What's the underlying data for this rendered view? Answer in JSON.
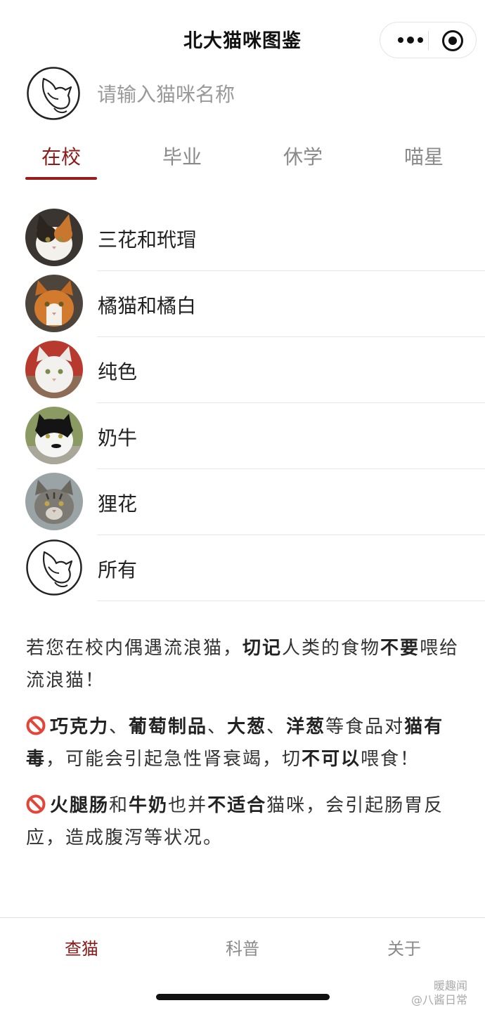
{
  "nav": {
    "title": "北大猫咪图鉴"
  },
  "search": {
    "placeholder": "请输入猫咪名称"
  },
  "tabs": [
    {
      "label": "在校",
      "active": true
    },
    {
      "label": "毕业",
      "active": false
    },
    {
      "label": "休学",
      "active": false
    },
    {
      "label": "喵星",
      "active": false
    }
  ],
  "categories": [
    {
      "label": "三花和玳瑁",
      "avatar": "calico-cat-photo"
    },
    {
      "label": "橘猫和橘白",
      "avatar": "orange-white-cat-photo"
    },
    {
      "label": "纯色",
      "avatar": "white-cat-photo"
    },
    {
      "label": "奶牛",
      "avatar": "tuxedo-cat-photo"
    },
    {
      "label": "狸花",
      "avatar": "tabby-cat-photo"
    },
    {
      "label": "所有",
      "avatar": "cat-logo-icon"
    }
  ],
  "notice": {
    "p1": {
      "a": "若您在校内偶遇流浪猫，",
      "b": "切记",
      "c": "人类的食物",
      "d": "不要",
      "e": "喂给流浪猫！"
    },
    "p2": {
      "icon": "prohibited-icon",
      "a": "巧克力",
      "b": "、",
      "c": "葡萄制品",
      "d": "、",
      "e": "大葱",
      "f": "、",
      "g": "洋葱",
      "h": "等食品对",
      "i": "猫有毒",
      "j": "，可能会引起急性肾衰竭，切",
      "k": "不可以",
      "l": "喂食！"
    },
    "p3": {
      "icon": "prohibited-icon",
      "a": "火腿肠",
      "b": "和",
      "c": "牛奶",
      "d": "也并",
      "e": "不适合",
      "f": "猫咪，会引起肠胃反应，造成腹泻等状况。"
    }
  },
  "tabbar": [
    {
      "label": "查猫",
      "active": true
    },
    {
      "label": "科普",
      "active": false
    },
    {
      "label": "关于",
      "active": false
    }
  ],
  "watermark": {
    "line1": "暖趣闻",
    "line2": "@八酱日常"
  },
  "colors": {
    "accent": "#8b1a1a",
    "text": "#222222",
    "muted": "#8a8a8a",
    "divider": "#e6e6e6"
  }
}
